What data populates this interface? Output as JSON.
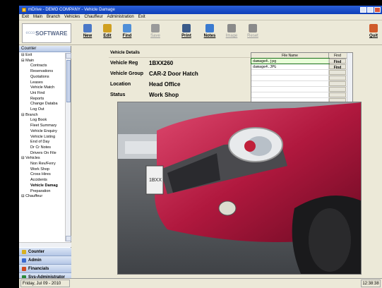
{
  "window": {
    "title": "mDrive - DEMO COMPANY - Vehicle Damage"
  },
  "menu": [
    "Exit",
    "Main",
    "Branch",
    "Vehicles",
    "Chauffeur",
    "Administration",
    "Exit"
  ],
  "logo": {
    "prefix": "ecco",
    "text": "SOFTWARE"
  },
  "toolbar": [
    {
      "label": "New",
      "icon": "new-document-icon",
      "enabled": true,
      "color": "#4a78c8"
    },
    {
      "label": "Edit",
      "icon": "edit-icon",
      "enabled": true,
      "color": "#d0a020"
    },
    {
      "label": "Find",
      "icon": "find-icon",
      "enabled": true,
      "color": "#4f8fd8"
    },
    {
      "label": "Save",
      "icon": "save-icon",
      "enabled": false,
      "color": "#9a9a9a"
    },
    {
      "label": "Print",
      "icon": "print-icon",
      "enabled": true,
      "color": "#3a5a8a"
    },
    {
      "label": "Notes",
      "icon": "notes-icon",
      "enabled": true,
      "color": "#3a7ad0"
    },
    {
      "label": "Image",
      "icon": "image-icon",
      "enabled": false,
      "color": "#8a8a8a"
    },
    {
      "label": "Reset",
      "icon": "reset-icon",
      "enabled": false,
      "color": "#8a8a8a"
    },
    {
      "label": "Quit",
      "icon": "quit-icon",
      "enabled": true,
      "color": "#d05a2a"
    }
  ],
  "sidebar": {
    "header": "Counter",
    "tree": [
      {
        "label": "Exit",
        "level": 0
      },
      {
        "label": "Main",
        "level": 0
      },
      {
        "label": "Contracts",
        "level": 1
      },
      {
        "label": "Reservations",
        "level": 1
      },
      {
        "label": "Quotations",
        "level": 1
      },
      {
        "label": "Leases",
        "level": 1
      },
      {
        "label": "Vehicle Match",
        "level": 1
      },
      {
        "label": "Uni Find",
        "level": 1
      },
      {
        "label": "Reports",
        "level": 1
      },
      {
        "label": "Change Databa",
        "level": 1
      },
      {
        "label": "Log Out",
        "level": 1
      },
      {
        "label": "Branch",
        "level": 0
      },
      {
        "label": "Log Book",
        "level": 1
      },
      {
        "label": "Fleet Summary",
        "level": 1
      },
      {
        "label": "Vehicle Enquiry",
        "level": 1
      },
      {
        "label": "Vehicle Listing",
        "level": 1
      },
      {
        "label": "End of Day",
        "level": 1
      },
      {
        "label": "Dr Cr Notes",
        "level": 1
      },
      {
        "label": "Drivers On File",
        "level": 1
      },
      {
        "label": "Vehicles",
        "level": 0
      },
      {
        "label": "Non Rev/Ferry",
        "level": 1
      },
      {
        "label": "Work Shop",
        "level": 1
      },
      {
        "label": "Cross Hires",
        "level": 1
      },
      {
        "label": "Accidents",
        "level": 1
      },
      {
        "label": "Vehicle Damag",
        "level": 1,
        "selected": true
      },
      {
        "label": "Preparation",
        "level": 1
      },
      {
        "label": "Chauffeur",
        "level": 0
      }
    ],
    "nav": [
      {
        "label": "Counter",
        "color": "#d8b020"
      },
      {
        "label": "Admin",
        "color": "#3a6ad0"
      },
      {
        "label": "Financials",
        "color": "#d04a20"
      },
      {
        "label": "Sys-Administrator",
        "color": "#2a8a3a"
      }
    ]
  },
  "details": {
    "header": "Vehicle Details",
    "rows": [
      {
        "key": "Vehicle Reg",
        "value": "1BXX260"
      },
      {
        "key": "Vehicle Group",
        "value": "CAR-2 Door Hatch"
      },
      {
        "key": "Location",
        "value": "Head Office"
      },
      {
        "key": "Status",
        "value": "Work Shop"
      }
    ]
  },
  "files": {
    "col_name": "File Name",
    "col_find": "Find",
    "rows": [
      {
        "name": "damage4.jpg",
        "find": "Find"
      },
      {
        "name": "damage4.JPG",
        "find": "Find"
      },
      {
        "name": "",
        "find": ""
      },
      {
        "name": "",
        "find": ""
      },
      {
        "name": "",
        "find": ""
      },
      {
        "name": "",
        "find": ""
      },
      {
        "name": "",
        "find": ""
      },
      {
        "name": "",
        "find": ""
      }
    ]
  },
  "status": {
    "date": "Friday, Jul 09 - 2010",
    "time": "12:38:38"
  }
}
